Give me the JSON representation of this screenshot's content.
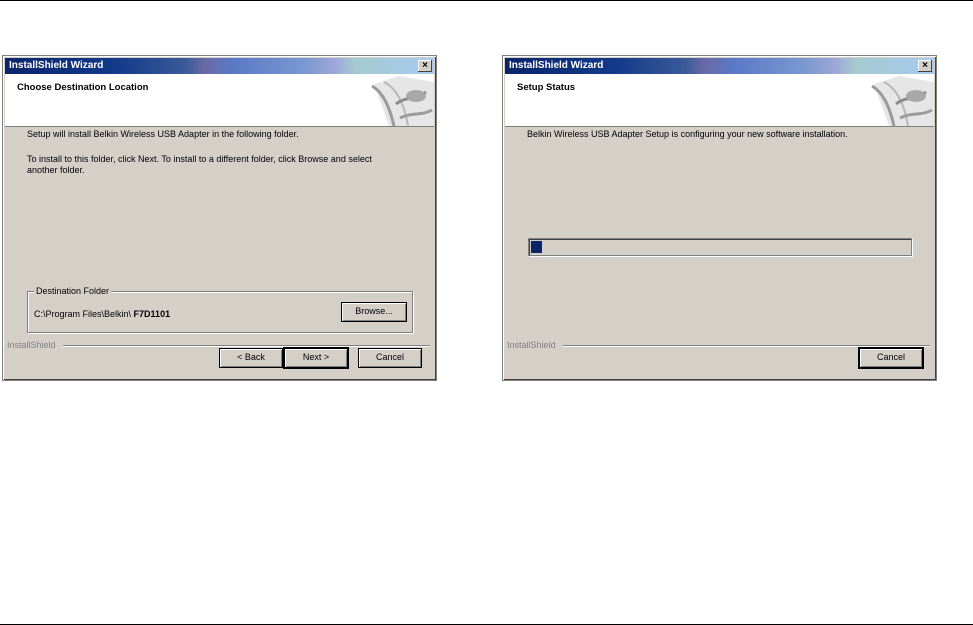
{
  "dialog_left": {
    "window_title": "InstallShield Wizard",
    "header_title": "Choose Destination Location",
    "body_line1": "Setup will install Belkin Wireless USB Adapter in the following folder.",
    "body_line2": "To install to this folder, click Next. To install to a different folder, click Browse and select",
    "body_line3": "another folder.",
    "group_label": "Destination Folder",
    "folder_path_prefix": "C:\\Program Files\\Belkin\\",
    "folder_path_bold": "F7D1101",
    "browse_label": "Browse...",
    "separator_label": "InstallShield",
    "back_label": "< Back",
    "next_label": "Next >",
    "cancel_label": "Cancel"
  },
  "dialog_right": {
    "window_title": "InstallShield Wizard",
    "header_title": "Setup Status",
    "body_line1": "Belkin Wireless USB Adapter Setup is configuring your new software installation.",
    "progress_fraction": 0.03,
    "separator_label": "InstallShield",
    "cancel_label": "Cancel"
  },
  "icons": {
    "close": "close-icon",
    "header_art": "installshield-graphic-icon"
  },
  "colors": {
    "dialog_face": "#d4d0c8",
    "title_active": "#0a246a",
    "progress_fill": "#0a246a"
  }
}
